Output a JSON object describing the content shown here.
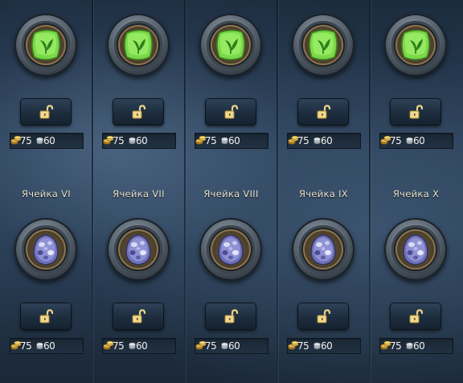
{
  "colors": {
    "gold": "#e0b040",
    "silver": "#c8cdd2",
    "leaf": "#5cc830",
    "egg": "#7a74b8"
  },
  "rows": [
    {
      "slots": [
        {
          "label": "",
          "icon": "green-leaf-gem-icon",
          "gold": "75",
          "silver": "60",
          "locked": false
        },
        {
          "label": "",
          "icon": "green-leaf-gem-icon",
          "gold": "75",
          "silver": "60",
          "locked": false
        },
        {
          "label": "",
          "icon": "green-leaf-gem-icon",
          "gold": "75",
          "silver": "60",
          "locked": false
        },
        {
          "label": "",
          "icon": "green-leaf-gem-icon",
          "gold": "75",
          "silver": "60",
          "locked": false
        },
        {
          "label": "",
          "icon": "green-leaf-gem-icon",
          "gold": "75",
          "silver": "60",
          "locked": false
        }
      ]
    },
    {
      "slots": [
        {
          "label": "Ячейка  VI",
          "icon": "spotted-egg-icon",
          "gold": "75",
          "silver": "60",
          "locked": false
        },
        {
          "label": "Ячейка  VII",
          "icon": "spotted-egg-icon",
          "gold": "75",
          "silver": "60",
          "locked": false
        },
        {
          "label": "Ячейка  VIII",
          "icon": "spotted-egg-icon",
          "gold": "75",
          "silver": "60",
          "locked": false
        },
        {
          "label": "Ячейка  IX",
          "icon": "spotted-egg-icon",
          "gold": "75",
          "silver": "60",
          "locked": false
        },
        {
          "label": "Ячейка  X",
          "icon": "spotted-egg-icon",
          "gold": "75",
          "silver": "60",
          "locked": false
        }
      ]
    }
  ]
}
